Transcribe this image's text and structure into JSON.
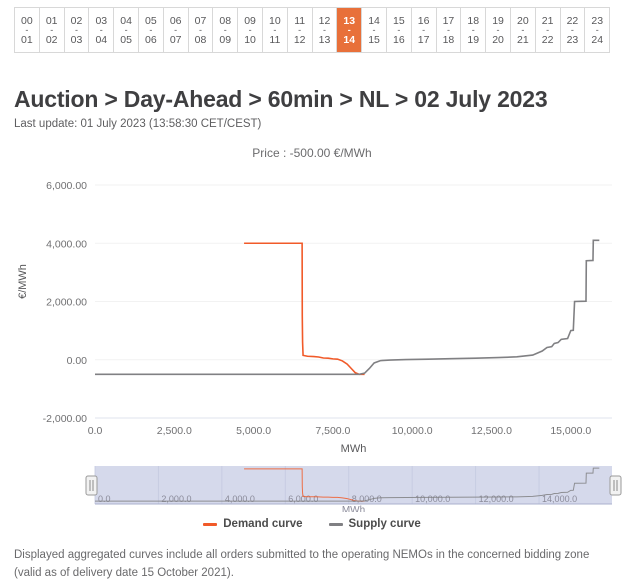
{
  "hour_selector": {
    "selected_index": 13,
    "cells": [
      {
        "from": "00",
        "sep": "-",
        "to": "01"
      },
      {
        "from": "01",
        "sep": "-",
        "to": "02"
      },
      {
        "from": "02",
        "sep": "-",
        "to": "03"
      },
      {
        "from": "03",
        "sep": "-",
        "to": "04"
      },
      {
        "from": "04",
        "sep": "-",
        "to": "05"
      },
      {
        "from": "05",
        "sep": "-",
        "to": "06"
      },
      {
        "from": "06",
        "sep": "-",
        "to": "07"
      },
      {
        "from": "07",
        "sep": "-",
        "to": "08"
      },
      {
        "from": "08",
        "sep": "-",
        "to": "09"
      },
      {
        "from": "09",
        "sep": "-",
        "to": "10"
      },
      {
        "from": "10",
        "sep": "-",
        "to": "11"
      },
      {
        "from": "11",
        "sep": "-",
        "to": "12"
      },
      {
        "from": "12",
        "sep": "-",
        "to": "13"
      },
      {
        "from": "13",
        "sep": "-",
        "to": "14"
      },
      {
        "from": "14",
        "sep": "-",
        "to": "15"
      },
      {
        "from": "15",
        "sep": "-",
        "to": "16"
      },
      {
        "from": "16",
        "sep": "-",
        "to": "17"
      },
      {
        "from": "17",
        "sep": "-",
        "to": "18"
      },
      {
        "from": "18",
        "sep": "-",
        "to": "19"
      },
      {
        "from": "19",
        "sep": "-",
        "to": "20"
      },
      {
        "from": "20",
        "sep": "-",
        "to": "21"
      },
      {
        "from": "21",
        "sep": "-",
        "to": "22"
      },
      {
        "from": "22",
        "sep": "-",
        "to": "23"
      },
      {
        "from": "23",
        "sep": "-",
        "to": "24"
      }
    ]
  },
  "header": {
    "title": "Auction > Day-Ahead > 60min > NL > 02 July 2023",
    "last_update": "Last update: 01 July 2023 (13:58:30 CET/CEST)"
  },
  "footer": {
    "note": "Displayed aggregated curves include all orders submitted to the operating NEMOs in the concerned bidding zone (valid as of delivery date 15 October 2021)."
  },
  "colors": {
    "accent_orange": "#e8703a",
    "demand": "#f15a29",
    "supply": "#808083",
    "navigator_fill": "#ccd1e8",
    "navigator_bg": "#dfe2f0"
  },
  "navigator": {
    "x_ticks": [
      "0.0",
      "2,000.0",
      "4,000.0",
      "6,000.0",
      "8,000.0",
      "10,000.0",
      "12,000.0",
      "14,000.0"
    ],
    "x_tick_values": [
      0,
      2000,
      4000,
      6000,
      8000,
      10000,
      12000,
      14000
    ],
    "xlabel": "MWh",
    "range_start": 0,
    "range_end": 100
  },
  "chart_data": {
    "type": "line",
    "title": "Price : -500.00 €/MWh",
    "xlabel": "MWh",
    "ylabel": "€/MWh",
    "xlim": [
      0,
      16300
    ],
    "ylim": [
      -2000,
      6000
    ],
    "x_ticks": [
      "0.0",
      "2,500.0",
      "5,000.0",
      "7,500.0",
      "10,000.0",
      "12,500.0",
      "15,000.0"
    ],
    "x_tick_values": [
      0,
      2500,
      5000,
      7500,
      10000,
      12500,
      15000
    ],
    "y_ticks": [
      "6,000.00",
      "4,000.00",
      "2,000.00",
      "0.00",
      "-2,000.00"
    ],
    "y_tick_values": [
      6000,
      4000,
      2000,
      0,
      -2000
    ],
    "grid": true,
    "legend_position": "bottom",
    "series": [
      {
        "name": "Demand curve",
        "color": "#f15a29",
        "points": [
          [
            4700,
            4000
          ],
          [
            6530,
            4000
          ],
          [
            6535,
            1500
          ],
          [
            6545,
            600
          ],
          [
            6560,
            150
          ],
          [
            6700,
            120
          ],
          [
            6900,
            110
          ],
          [
            7050,
            95
          ],
          [
            7200,
            60
          ],
          [
            7350,
            55
          ],
          [
            7500,
            30
          ],
          [
            7650,
            20
          ],
          [
            7800,
            -40
          ],
          [
            7950,
            -150
          ],
          [
            8080,
            -300
          ],
          [
            8200,
            -440
          ],
          [
            8330,
            -500
          ],
          [
            8500,
            -500
          ]
        ]
      },
      {
        "name": "Supply curve",
        "color": "#808083",
        "points": [
          [
            0,
            -500
          ],
          [
            1000,
            -500
          ],
          [
            2000,
            -500
          ],
          [
            3000,
            -500
          ],
          [
            4000,
            -500
          ],
          [
            5000,
            -500
          ],
          [
            6000,
            -500
          ],
          [
            7000,
            -500
          ],
          [
            8000,
            -500
          ],
          [
            8330,
            -500
          ],
          [
            8500,
            -460
          ],
          [
            8650,
            -300
          ],
          [
            8800,
            -110
          ],
          [
            9000,
            -30
          ],
          [
            9300,
            -10
          ],
          [
            9800,
            5
          ],
          [
            10500,
            20
          ],
          [
            11200,
            35
          ],
          [
            12000,
            55
          ],
          [
            12700,
            75
          ],
          [
            13300,
            100
          ],
          [
            13800,
            160
          ],
          [
            14100,
            300
          ],
          [
            14250,
            420
          ],
          [
            14400,
            450
          ],
          [
            14480,
            560
          ],
          [
            14600,
            590
          ],
          [
            14700,
            700
          ],
          [
            14900,
            730
          ],
          [
            15000,
            1000
          ],
          [
            15080,
            1010
          ],
          [
            15120,
            2000
          ],
          [
            15480,
            2010
          ],
          [
            15490,
            3400
          ],
          [
            15700,
            3410
          ],
          [
            15710,
            4100
          ],
          [
            15900,
            4100
          ]
        ]
      }
    ],
    "legend": [
      {
        "label": "Demand curve",
        "color": "#f15a29"
      },
      {
        "label": "Supply curve",
        "color": "#808083"
      }
    ]
  }
}
